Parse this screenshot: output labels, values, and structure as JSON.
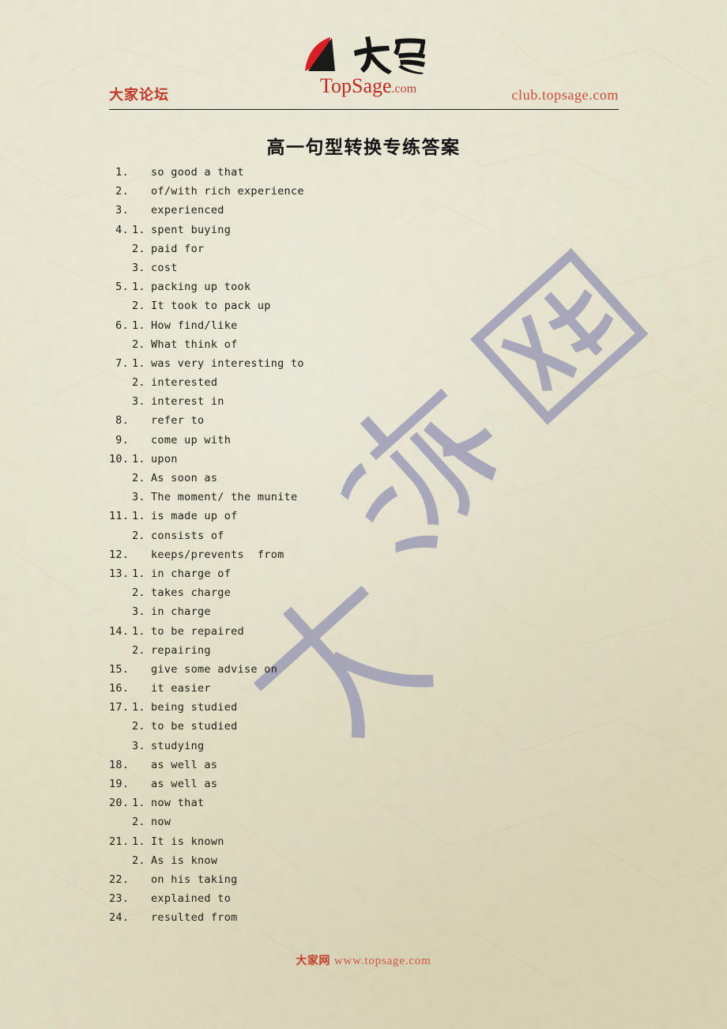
{
  "header": {
    "forum_name": "大家论坛",
    "club_url": "club.topsage.com",
    "logo": {
      "brand_top": "Top",
      "brand_mid": "Sage",
      "brand_dotcom": ".com",
      "brand_cn": "大家",
      "mark_red": "#d81f26",
      "mark_black": "#1a1a1a"
    }
  },
  "title": "高一句型转换专练答案",
  "watermark": {
    "text": "大流网",
    "color": "#9a99b5"
  },
  "colors": {
    "paper": "#e9e5ca",
    "red": "#c0392b",
    "ink": "#222018"
  },
  "answers": [
    {
      "num": "1.",
      "sub": "",
      "text": "so good a that"
    },
    {
      "num": "2.",
      "sub": "",
      "text": "of/with rich experience"
    },
    {
      "num": "3.",
      "sub": "",
      "text": "experienced"
    },
    {
      "num": "4.",
      "sub": "1.",
      "text": "spent buying"
    },
    {
      "num": "",
      "sub": "2.",
      "text": "paid for"
    },
    {
      "num": "",
      "sub": "3.",
      "text": "cost"
    },
    {
      "num": "5.",
      "sub": "1.",
      "text": "packing up took"
    },
    {
      "num": "",
      "sub": "2.",
      "text": "It took to pack up"
    },
    {
      "num": "6.",
      "sub": "1.",
      "text": "How find/like"
    },
    {
      "num": "",
      "sub": "2.",
      "text": "What think of"
    },
    {
      "num": "7.",
      "sub": "1.",
      "text": "was very interesting to"
    },
    {
      "num": "",
      "sub": "2.",
      "text": "interested"
    },
    {
      "num": "",
      "sub": "3.",
      "text": "interest in"
    },
    {
      "num": "8.",
      "sub": "",
      "text": "refer to"
    },
    {
      "num": "9.",
      "sub": "",
      "text": "come up with"
    },
    {
      "num": "10.",
      "sub": "1.",
      "text": "upon"
    },
    {
      "num": "",
      "sub": "2.",
      "text": "As soon as"
    },
    {
      "num": "",
      "sub": "3.",
      "text": "The moment/ the munite"
    },
    {
      "num": "11.",
      "sub": "1.",
      "text": "is made up of"
    },
    {
      "num": "",
      "sub": "2.",
      "text": "consists of"
    },
    {
      "num": "12.",
      "sub": "",
      "text": "keeps/prevents  from"
    },
    {
      "num": "13.",
      "sub": "1.",
      "text": "in charge of"
    },
    {
      "num": "",
      "sub": "2.",
      "text": "takes charge"
    },
    {
      "num": "",
      "sub": "3.",
      "text": "in charge"
    },
    {
      "num": "14.",
      "sub": "1.",
      "text": "to be repaired"
    },
    {
      "num": "",
      "sub": "2.",
      "text": "repairing"
    },
    {
      "num": "15.",
      "sub": "",
      "text": "give some advise on"
    },
    {
      "num": "16.",
      "sub": "",
      "text": "it easier"
    },
    {
      "num": "17.",
      "sub": "1.",
      "text": "being studied"
    },
    {
      "num": "",
      "sub": "2.",
      "text": "to be studied"
    },
    {
      "num": "",
      "sub": "3.",
      "text": "studying"
    },
    {
      "num": "18.",
      "sub": "",
      "text": "as well as"
    },
    {
      "num": "19.",
      "sub": "",
      "text": "as well as"
    },
    {
      "num": "20.",
      "sub": "1.",
      "text": "now that"
    },
    {
      "num": "",
      "sub": "2.",
      "text": "now"
    },
    {
      "num": "21.",
      "sub": "1.",
      "text": "It is known"
    },
    {
      "num": "",
      "sub": "2.",
      "text": "As is know"
    },
    {
      "num": "22.",
      "sub": "",
      "text": "on his taking"
    },
    {
      "num": "23.",
      "sub": "",
      "text": "explained to"
    },
    {
      "num": "24.",
      "sub": "",
      "text": "resulted from"
    }
  ],
  "footer": {
    "site_cn": "大家网",
    "site_url": "www.topsage.com"
  }
}
